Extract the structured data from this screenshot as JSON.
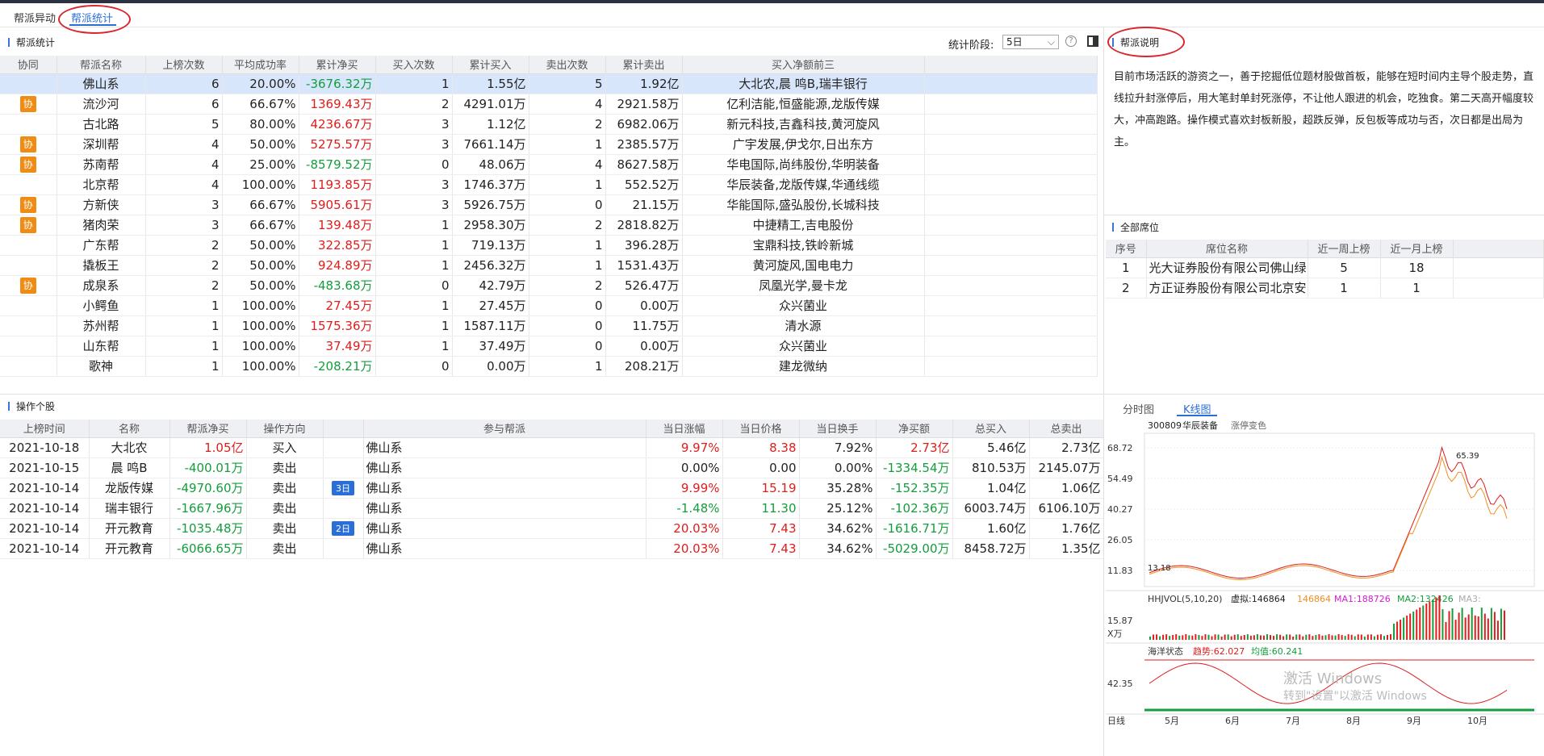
{
  "tabs": [
    "帮派异动",
    "帮派统计"
  ],
  "left_section_title": "帮派统计",
  "period": {
    "label": "统计阶段:",
    "value": "5日"
  },
  "gang_headers": [
    "协同",
    "帮派名称",
    "上榜次数",
    "平均成功率",
    "累计净买",
    "买入次数",
    "累计买入",
    "卖出次数",
    "累计卖出",
    "买入净额前三"
  ],
  "gangs": [
    {
      "xie": "",
      "name": "佛山系",
      "times": "6",
      "rate": "20.00%",
      "net": "-3676.32万",
      "net_color": "green",
      "buy_n": "1",
      "buy_amt": "1.55亿",
      "sell_n": "5",
      "sell_amt": "1.92亿",
      "top3": "大北农,晨  鸣B,瑞丰银行"
    },
    {
      "xie": "协",
      "name": "流沙河",
      "times": "6",
      "rate": "66.67%",
      "net": "1369.43万",
      "net_color": "red",
      "buy_n": "2",
      "buy_amt": "4291.01万",
      "sell_n": "4",
      "sell_amt": "2921.58万",
      "top3": "亿利洁能,恒盛能源,龙版传媒"
    },
    {
      "xie": "",
      "name": "古北路",
      "times": "5",
      "rate": "80.00%",
      "net": "4236.67万",
      "net_color": "red",
      "buy_n": "3",
      "buy_amt": "1.12亿",
      "sell_n": "2",
      "sell_amt": "6982.06万",
      "top3": "新元科技,吉鑫科技,黄河旋风"
    },
    {
      "xie": "协",
      "name": "深圳帮",
      "times": "4",
      "rate": "50.00%",
      "net": "5275.57万",
      "net_color": "red",
      "buy_n": "3",
      "buy_amt": "7661.14万",
      "sell_n": "1",
      "sell_amt": "2385.57万",
      "top3": "广宇发展,伊戈尔,日出东方"
    },
    {
      "xie": "协",
      "name": "苏南帮",
      "times": "4",
      "rate": "25.00%",
      "net": "-8579.52万",
      "net_color": "green",
      "buy_n": "0",
      "buy_amt": "48.06万",
      "sell_n": "4",
      "sell_amt": "8627.58万",
      "top3": "华电国际,尚纬股份,华明装备"
    },
    {
      "xie": "",
      "name": "北京帮",
      "times": "4",
      "rate": "100.00%",
      "net": "1193.85万",
      "net_color": "red",
      "buy_n": "3",
      "buy_amt": "1746.37万",
      "sell_n": "1",
      "sell_amt": "552.52万",
      "top3": "华辰装备,龙版传媒,华通线缆"
    },
    {
      "xie": "协",
      "name": "方新侠",
      "times": "3",
      "rate": "66.67%",
      "net": "5905.61万",
      "net_color": "red",
      "buy_n": "3",
      "buy_amt": "5926.75万",
      "sell_n": "0",
      "sell_amt": "21.15万",
      "top3": "华能国际,盛弘股份,长城科技"
    },
    {
      "xie": "协",
      "name": "猪肉荣",
      "times": "3",
      "rate": "66.67%",
      "net": "139.48万",
      "net_color": "red",
      "buy_n": "1",
      "buy_amt": "2958.30万",
      "sell_n": "2",
      "sell_amt": "2818.82万",
      "top3": "中捷精工,吉电股份"
    },
    {
      "xie": "",
      "name": "广东帮",
      "times": "2",
      "rate": "50.00%",
      "net": "322.85万",
      "net_color": "red",
      "buy_n": "1",
      "buy_amt": "719.13万",
      "sell_n": "1",
      "sell_amt": "396.28万",
      "top3": "宝鼎科技,铁岭新城"
    },
    {
      "xie": "",
      "name": "撬板王",
      "times": "2",
      "rate": "50.00%",
      "net": "924.89万",
      "net_color": "red",
      "buy_n": "1",
      "buy_amt": "2456.32万",
      "sell_n": "1",
      "sell_amt": "1531.43万",
      "top3": "黄河旋风,国电电力"
    },
    {
      "xie": "协",
      "name": "成泉系",
      "times": "2",
      "rate": "50.00%",
      "net": "-483.68万",
      "net_color": "green",
      "buy_n": "0",
      "buy_amt": "42.79万",
      "sell_n": "2",
      "sell_amt": "526.47万",
      "top3": "凤凰光学,曼卡龙"
    },
    {
      "xie": "",
      "name": "小鳄鱼",
      "times": "1",
      "rate": "100.00%",
      "net": "27.45万",
      "net_color": "red",
      "buy_n": "1",
      "buy_amt": "27.45万",
      "sell_n": "0",
      "sell_amt": "0.00万",
      "top3": "众兴菌业"
    },
    {
      "xie": "",
      "name": "苏州帮",
      "times": "1",
      "rate": "100.00%",
      "net": "1575.36万",
      "net_color": "red",
      "buy_n": "1",
      "buy_amt": "1587.11万",
      "sell_n": "0",
      "sell_amt": "11.75万",
      "top3": "清水源"
    },
    {
      "xie": "",
      "name": "山东帮",
      "times": "1",
      "rate": "100.00%",
      "net": "37.49万",
      "net_color": "red",
      "buy_n": "1",
      "buy_amt": "37.49万",
      "sell_n": "0",
      "sell_amt": "0.00万",
      "top3": "众兴菌业"
    },
    {
      "xie": "",
      "name": "歌神",
      "times": "1",
      "rate": "100.00%",
      "net": "-208.21万",
      "net_color": "green",
      "buy_n": "0",
      "buy_amt": "0.00万",
      "sell_n": "1",
      "sell_amt": "208.21万",
      "top3": "建龙微纳"
    }
  ],
  "ops_title": "操作个股",
  "ops_headers": [
    "上榜时间",
    "名称",
    "帮派净买",
    "操作方向",
    "",
    "参与帮派",
    "当日涨幅",
    "当日价格",
    "当日换手",
    "净买额",
    "总买入",
    "总卖出"
  ],
  "ops": [
    {
      "date": "2021-10-18",
      "name": "大北农",
      "net": "1.05亿",
      "net_color": "red",
      "dir": "买入",
      "tag": "",
      "gang": "佛山系",
      "chg": "9.97%",
      "chg_color": "red",
      "price": "8.38",
      "price_color": "red",
      "turn": "7.92%",
      "netamt": "2.73亿",
      "netamt_color": "red",
      "buy": "5.46亿",
      "sell": "2.73亿"
    },
    {
      "date": "2021-10-15",
      "name": "晨  鸣B",
      "net": "-400.01万",
      "net_color": "green",
      "dir": "卖出",
      "tag": "",
      "gang": "佛山系",
      "chg": "0.00%",
      "chg_color": "",
      "price": "0.00",
      "price_color": "",
      "turn": "0.00%",
      "netamt": "-1334.54万",
      "netamt_color": "green",
      "buy": "810.53万",
      "sell": "2145.07万"
    },
    {
      "date": "2021-10-14",
      "name": "龙版传媒",
      "net": "-4970.60万",
      "net_color": "green",
      "dir": "卖出",
      "tag": "3日",
      "gang": "佛山系",
      "chg": "9.99%",
      "chg_color": "red",
      "price": "15.19",
      "price_color": "red",
      "turn": "35.28%",
      "netamt": "-152.35万",
      "netamt_color": "green",
      "buy": "1.04亿",
      "sell": "1.06亿"
    },
    {
      "date": "2021-10-14",
      "name": "瑞丰银行",
      "net": "-1667.96万",
      "net_color": "green",
      "dir": "卖出",
      "tag": "",
      "gang": "佛山系",
      "chg": "-1.48%",
      "chg_color": "green",
      "price": "11.30",
      "price_color": "green",
      "turn": "25.12%",
      "netamt": "-102.36万",
      "netamt_color": "green",
      "buy": "6003.74万",
      "sell": "6106.10万"
    },
    {
      "date": "2021-10-14",
      "name": "开元教育",
      "net": "-1035.48万",
      "net_color": "green",
      "dir": "卖出",
      "tag": "2日",
      "gang": "佛山系",
      "chg": "20.03%",
      "chg_color": "red",
      "price": "7.43",
      "price_color": "red",
      "turn": "34.62%",
      "netamt": "-1616.71万",
      "netamt_color": "green",
      "buy": "1.60亿",
      "sell": "1.76亿"
    },
    {
      "date": "2021-10-14",
      "name": "开元教育",
      "net": "-6066.65万",
      "net_color": "green",
      "dir": "卖出",
      "tag": "",
      "gang": "佛山系",
      "chg": "20.03%",
      "chg_color": "red",
      "price": "7.43",
      "price_color": "red",
      "turn": "34.62%",
      "netamt": "-5029.00万",
      "netamt_color": "green",
      "buy": "8458.72万",
      "sell": "1.35亿"
    }
  ],
  "explain_title": "帮派说明",
  "explain_text": "目前市场活跃的游资之一，善于挖掘低位题材股做首板，能够在短时间内主导个股走势，直线拉升封涨停后，用大笔封单封死涨停，不让他人跟进的机会，吃独食。第二天高开幅度较大，冲高跑路。操作模式喜欢封板新股，超跌反弹，反包板等成功与否，次日都是出局为主。",
  "seats_title": "全部席位",
  "seat_headers": [
    "序号",
    "席位名称",
    "近一周上榜",
    "近一月上榜"
  ],
  "seats": [
    {
      "no": "1",
      "name": "光大证券股份有限公司佛山绿...",
      "week": "5",
      "month": "18"
    },
    {
      "no": "2",
      "name": "方正证券股份有限公司北京安...",
      "week": "1",
      "month": "1"
    }
  ],
  "chart_tabs": [
    "分时图",
    "K线图"
  ],
  "stock": {
    "code": "300809",
    "name": "华辰装备",
    "toggle": "涨停变色"
  },
  "kline": {
    "yticks": [
      "68.72",
      "54.49",
      "40.27",
      "26.05",
      "11.83"
    ],
    "high_label": "65.39",
    "low_label": "13.18"
  },
  "vol": {
    "label": "HHJVOL(5,10,20)",
    "virtual": "虚拟:146864",
    "v": "146864",
    "ma1": "MA1:188726",
    "ma2": "MA2:132426",
    "ma3": "MA3:",
    "ytick": "15.87",
    "unit": "X万"
  },
  "osc": {
    "label": "海洋状态",
    "trend": "趋势:62.027",
    "avg": "均值:60.241",
    "ytick": "42.35"
  },
  "xaxis": [
    "日线",
    "5月",
    "6月",
    "7月",
    "8月",
    "9月",
    "10月"
  ],
  "watermark": "激活 Windows",
  "watermark2": "转到\"设置\"以激活 Windows",
  "colors": {
    "accent": "#2a6fd6",
    "up": "#e01c1c",
    "down": "#139d3c",
    "xie": "#f08c14"
  }
}
